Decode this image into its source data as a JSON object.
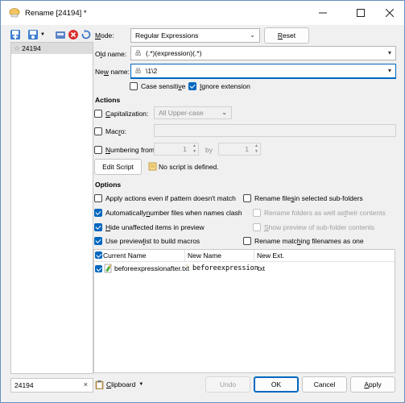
{
  "window": {
    "title": "Rename [24194] *",
    "icons": [
      "rename-app-icon",
      "minimize-icon",
      "maximize-icon",
      "close-icon"
    ]
  },
  "left_pane": {
    "toolbar_icons": [
      "add-preset-icon",
      "add-from-list-icon",
      "save-preset-icon",
      "delete-preset-icon",
      "reset-icon"
    ],
    "list_items": [
      {
        "label": "24194"
      }
    ],
    "filter": {
      "value": "24194",
      "clear_label": "×"
    }
  },
  "mode": {
    "label_pre": "",
    "label_underlined": "M",
    "label_post": "ode:",
    "value": "Regular Expressions",
    "reset_pre": "",
    "reset_underlined": "R",
    "reset_post": "eset"
  },
  "old_name": {
    "label_pre": "O",
    "label_underlined": "l",
    "label_post": "d name:",
    "value": "(.*)(expression)(.*)"
  },
  "new_name": {
    "label_pre": "Ne",
    "label_underlined": "w",
    "label_post": " name:",
    "value": "\\1\\2"
  },
  "flags": {
    "case_sensitive": {
      "pre": "Case sensiti",
      "u": "v",
      "post": "e",
      "checked": false
    },
    "ignore_extension": {
      "pre": "",
      "u": "I",
      "post": "gnore extension",
      "checked": true
    }
  },
  "actions": {
    "heading": "Actions",
    "capitalization": {
      "pre": "",
      "u": "C",
      "post": "apitalization:",
      "checked": false,
      "value": "All Upper-case"
    },
    "macro": {
      "pre": "Mac",
      "u": "r",
      "post": "o:",
      "checked": false
    },
    "numbering": {
      "pre": "",
      "u": "N",
      "post": "umbering from:",
      "checked": false,
      "from": "1",
      "by_label": "by",
      "by": "1"
    },
    "edit_script": "Edit Script",
    "no_script": "No script is defined."
  },
  "options": {
    "heading": "Options",
    "left": [
      {
        "pre": "Apply actions even if pattern doesn't match",
        "u": "",
        "post": "",
        "checked": false,
        "disabled": false
      },
      {
        "pre": "Automatically ",
        "u": "n",
        "post": "umber files when names clash",
        "checked": true,
        "disabled": false
      },
      {
        "pre": "",
        "u": "H",
        "post": "ide unaffected items in preview",
        "checked": true,
        "disabled": false
      },
      {
        "pre": "Use preview ",
        "u": "l",
        "post": "ist to build macros",
        "checked": true,
        "disabled": false
      }
    ],
    "right": [
      {
        "pre": "Rename file",
        "u": "s",
        "post": " in selected sub-folders",
        "checked": false,
        "disabled": false
      },
      {
        "pre": "Rename folders as well as ",
        "u": "t",
        "post": "heir contents",
        "checked": false,
        "disabled": true
      },
      {
        "pre": "",
        "u": "S",
        "post": "how preview of sub-folder contents",
        "checked": false,
        "disabled": true
      },
      {
        "pre": "Rename matc",
        "u": "h",
        "post": "ing filenames as one",
        "checked": false,
        "disabled": false
      }
    ]
  },
  "preview": {
    "headers": [
      "Current Name",
      "New Name",
      "New Ext."
    ],
    "rows": [
      {
        "checked": true,
        "current": "beforeexpressionafter.txt",
        "new_name": "beforeexpression",
        "new_ext": "txt"
      }
    ]
  },
  "bottom": {
    "clipboard": {
      "pre": "",
      "u": "C",
      "post": "lipboard"
    },
    "undo": "Undo",
    "ok": "OK",
    "cancel": "Cancel",
    "apply": {
      "pre": "",
      "u": "A",
      "post": "pply"
    }
  },
  "colors": {
    "accent": "#0067c0",
    "window_bg": "#f0f0f0"
  }
}
